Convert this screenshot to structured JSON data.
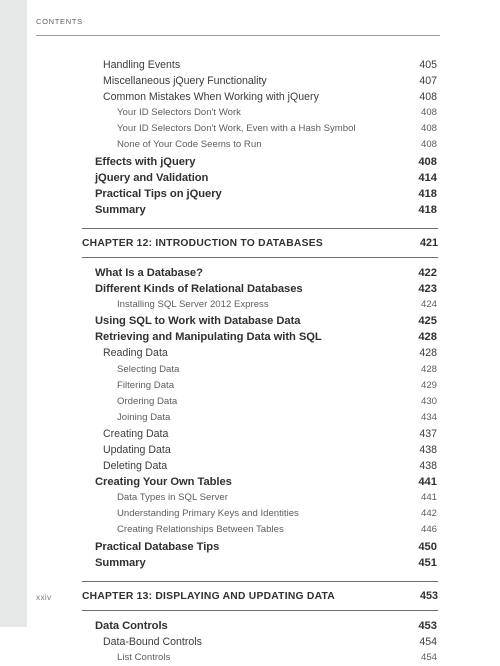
{
  "page": {
    "running_head": "CONTENTS",
    "folio": "xxiv"
  },
  "colors": {
    "margin_strip": "#e6e7e7",
    "rule": "#6d6f72",
    "head_rule": "#9a9c9f",
    "text_primary": "#2f3132",
    "text_secondary": "#3a3c3e",
    "text_tertiary": "#5c5e61",
    "page_background": "#ffffff"
  },
  "entries": [
    {
      "level": 2,
      "title": "Handling Events",
      "page": "405"
    },
    {
      "level": 2,
      "title": "Miscellaneous jQuery Functionality",
      "page": "407"
    },
    {
      "level": 2,
      "title": "Common Mistakes When Working with jQuery",
      "page": "408"
    },
    {
      "level": 3,
      "title": "Your ID Selectors Don't Work",
      "page": "408"
    },
    {
      "level": 3,
      "title": "Your ID Selectors Don't Work, Even with a Hash Symbol",
      "page": "408"
    },
    {
      "level": 3,
      "title": "None of Your Code Seems to Run",
      "page": "408"
    },
    {
      "level": 1,
      "title": "Effects with jQuery",
      "page": "408"
    },
    {
      "level": 1,
      "title": "jQuery and Validation",
      "page": "414"
    },
    {
      "level": 1,
      "title": "Practical Tips on jQuery",
      "page": "418"
    },
    {
      "level": 1,
      "title": "Summary",
      "page": "418"
    },
    {
      "level": 0,
      "title": "CHAPTER 12: INTRODUCTION TO DATABASES",
      "page": "421"
    },
    {
      "level": 1,
      "title": "What Is a Database?",
      "page": "422"
    },
    {
      "level": 1,
      "title": "Different Kinds of Relational Databases",
      "page": "423"
    },
    {
      "level": 3,
      "title": "Installing SQL Server 2012 Express",
      "page": "424"
    },
    {
      "level": 1,
      "title": "Using SQL to Work with Database Data",
      "page": "425"
    },
    {
      "level": 1,
      "title": "Retrieving and Manipulating Data with SQL",
      "page": "428"
    },
    {
      "level": 2,
      "title": "Reading Data",
      "page": "428"
    },
    {
      "level": 3,
      "title": "Selecting Data",
      "page": "428"
    },
    {
      "level": 3,
      "title": "Filtering Data",
      "page": "429"
    },
    {
      "level": 3,
      "title": "Ordering Data",
      "page": "430"
    },
    {
      "level": 3,
      "title": "Joining Data",
      "page": "434"
    },
    {
      "level": 2,
      "title": "Creating Data",
      "page": "437"
    },
    {
      "level": 2,
      "title": "Updating Data",
      "page": "438"
    },
    {
      "level": 2,
      "title": "Deleting Data",
      "page": "438"
    },
    {
      "level": 1,
      "title": "Creating Your Own Tables",
      "page": "441"
    },
    {
      "level": 3,
      "title": "Data Types in SQL Server",
      "page": "441"
    },
    {
      "level": 3,
      "title": "Understanding Primary Keys and Identities",
      "page": "442"
    },
    {
      "level": 3,
      "title": "Creating Relationships Between Tables",
      "page": "446"
    },
    {
      "level": 1,
      "title": "Practical Database Tips",
      "page": "450"
    },
    {
      "level": 1,
      "title": "Summary",
      "page": "451"
    },
    {
      "level": 0,
      "title": "CHAPTER 13: DISPLAYING AND UPDATING DATA",
      "page": "453"
    },
    {
      "level": 1,
      "title": "Data Controls",
      "page": "453"
    },
    {
      "level": 2,
      "title": "Data-Bound Controls",
      "page": "454"
    },
    {
      "level": 3,
      "title": "List Controls",
      "page": "454"
    }
  ]
}
